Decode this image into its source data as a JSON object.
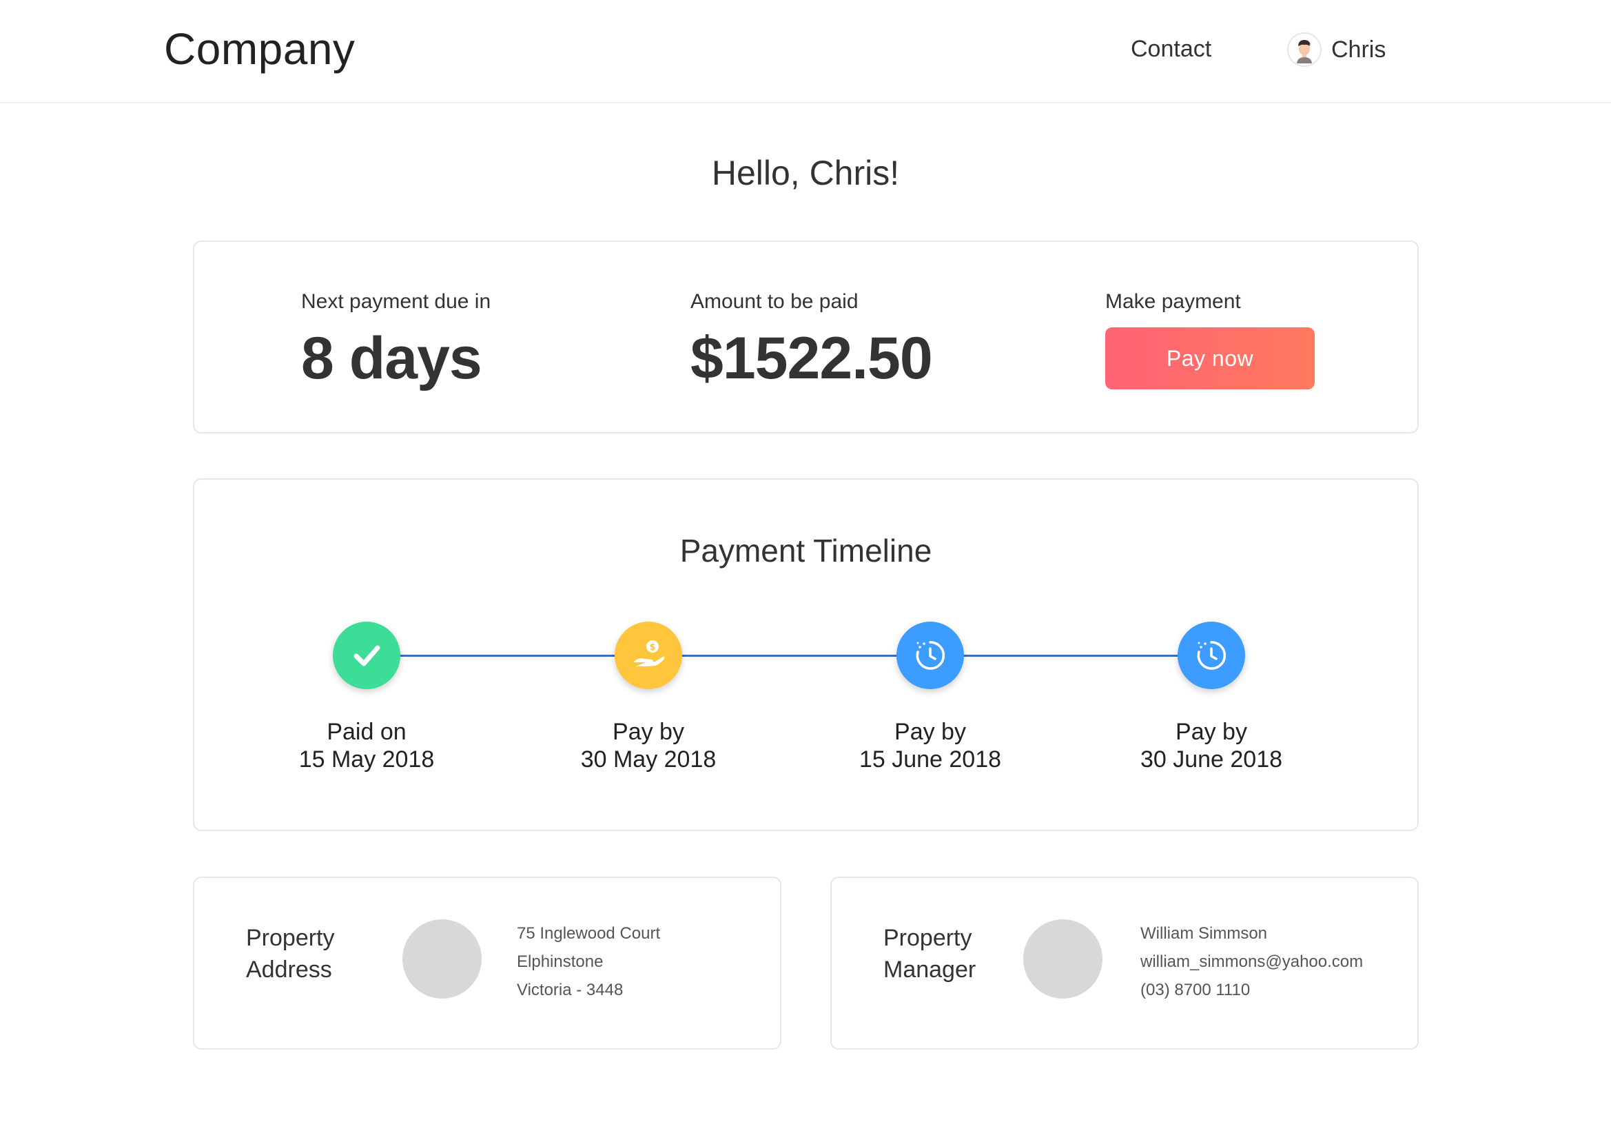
{
  "header": {
    "logo": "Company",
    "nav_contact": "Contact",
    "user_name": "Chris"
  },
  "greeting": "Hello, Chris!",
  "summary": {
    "due_label": "Next payment due in",
    "due_value": "8 days",
    "amount_label": "Amount to be paid",
    "amount_value": "$1522.50",
    "make_payment_label": "Make payment",
    "pay_button": "Pay now"
  },
  "timeline": {
    "title": "Payment Timeline",
    "steps": [
      {
        "line1": "Paid on",
        "line2": "15 May 2018",
        "status": "paid",
        "icon": "check-icon",
        "color": "#3ddc97"
      },
      {
        "line1": "Pay by",
        "line2": "30 May 2018",
        "status": "due",
        "icon": "hand-coin-icon",
        "color": "#ffc53d"
      },
      {
        "line1": "Pay by",
        "line2": "15 June 2018",
        "status": "upcoming",
        "icon": "timer-icon",
        "color": "#3d9cff"
      },
      {
        "line1": "Pay by",
        "line2": "30 June 2018",
        "status": "upcoming",
        "icon": "timer-icon",
        "color": "#3d9cff"
      }
    ]
  },
  "property_address": {
    "title_line1": "Property",
    "title_line2": "Address",
    "lines": [
      "75 Inglewood Court",
      "Elphinstone",
      "Victoria - 3448"
    ]
  },
  "property_manager": {
    "title_line1": "Property",
    "title_line2": "Manager",
    "lines": [
      "William Simmson",
      "william_simmons@yahoo.com",
      "(03) 8700 1110"
    ]
  },
  "colors": {
    "accent_gradient_start": "#ff6374",
    "accent_gradient_end": "#ff7a5f",
    "timeline_line": "#3a6fc4"
  }
}
